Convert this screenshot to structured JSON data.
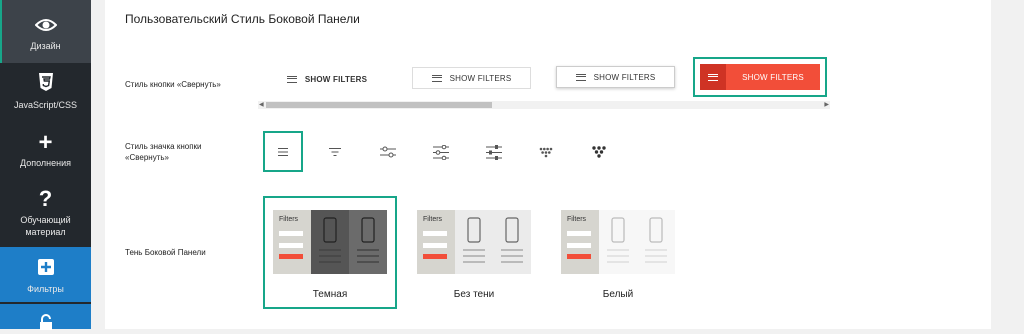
{
  "sidebar": {
    "items": [
      {
        "label": "Дизайн",
        "icon": "eye-icon"
      },
      {
        "label": "JavaScript/CSS",
        "icon": "css3-icon"
      },
      {
        "label": "Дополнения",
        "icon": "plus-icon"
      },
      {
        "label": "Обучающий материал",
        "icon": "question-icon"
      },
      {
        "label": "Фильтры",
        "icon": "filter-plus-icon"
      },
      {
        "label": "",
        "icon": "lock-icon"
      }
    ]
  },
  "main": {
    "title": "Пользовательский Стиль Боковой Панели",
    "collapse_button_style": {
      "label": "Стиль кнопки «Свернуть»",
      "options": [
        "SHOW FILTERS",
        "SHOW FILTERS",
        "SHOW FILTERS",
        "SHOW FILTERS"
      ],
      "selected_index": 3
    },
    "collapse_icon_style": {
      "label": "Стиль значка кнопки «Свернуть»",
      "icons": [
        "hamburger-icon",
        "filter-lines-icon",
        "sliders-horizontal-icon",
        "sliders-horizontal-alt-icon",
        "sliders-equalizer-icon",
        "dots-triangle-icon",
        "dots-triangle-bold-icon"
      ],
      "selected_index": 0
    },
    "sidebar_shadow": {
      "label": "Тень Боковой Панели",
      "options": [
        {
          "label": "Темная",
          "preview_title": "Filters"
        },
        {
          "label": "Без тени",
          "preview_title": "Filters"
        },
        {
          "label": "Белый",
          "preview_title": "Filters"
        }
      ],
      "selected_index": 0
    }
  },
  "colors": {
    "accent": "#17a689",
    "sidebar_bg": "#23282d",
    "button_red": "#f24e39",
    "button_red_dark": "#cf3324",
    "sidebar_blue": "#1e7ec8"
  }
}
